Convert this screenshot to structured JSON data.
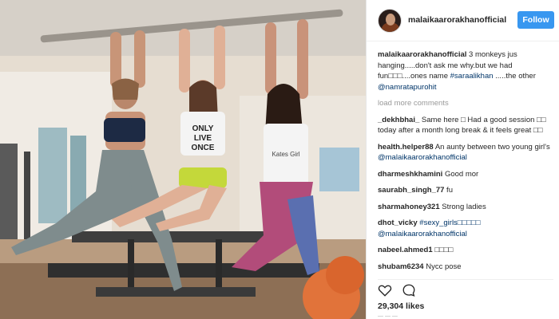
{
  "post": {
    "username": "malaikaarorakhanofficial",
    "follow_label": "Follow",
    "caption": {
      "user": "malaikaarorakhanofficial",
      "text_1": " 3 monkeys jus hanging.....don't ask me why.but we had fun",
      "glyphs_1": "□□□",
      "text_2": "....ones name ",
      "mention_1": "#saraalikhan",
      "text_3": " .....the other ",
      "mention_2": "@namratapurohit"
    },
    "load_more": "load more comments",
    "comments": [
      {
        "user": "_dekhbhai_",
        "text": " Same here □ Had a good session □□ today after a month long break & it feels great □□"
      },
      {
        "user": "health.helper88",
        "text": " An aunty between two young girl's ",
        "mention": "@malaikaarorakhanofficial"
      },
      {
        "user": "dharmeshkhamini",
        "text": " Good mor"
      },
      {
        "user": "saurabh_singh_77",
        "text": " fu"
      },
      {
        "user": "sharmahoney321",
        "text": " Strong ladies"
      },
      {
        "user": "dhot_vicky",
        "text": " ",
        "tag": "#sexy_girls□□□□□",
        "mention": "@malaikaarorakhanofficial"
      },
      {
        "user": "nabeel.ahmed1",
        "text": " □□□□"
      },
      {
        "user": "shubam6234",
        "text": " Nycc pose"
      }
    ],
    "likes": "29,304 likes",
    "icons": {
      "like": "heart-icon",
      "comment": "comment-icon"
    }
  },
  "photo": {
    "shirt_1_text": "ONLY LIVE ONCE",
    "shirt_2_text": "Kates Girl"
  }
}
